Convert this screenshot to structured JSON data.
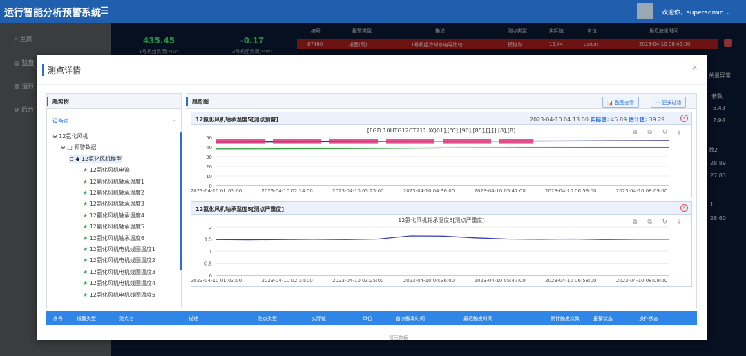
{
  "app": {
    "title": "运行智能分析预警系统",
    "menu_icon": "☰",
    "welcome": "欢迎你，superadmin ⌄"
  },
  "sidebar": {
    "items": [
      {
        "icon": "home-icon",
        "glyph": "⌂",
        "label": "主页"
      },
      {
        "icon": "doc-icon",
        "glyph": "▤",
        "label": "监盘"
      },
      {
        "icon": "doc-icon",
        "glyph": "▤",
        "label": "运行"
      },
      {
        "icon": "gear-icon",
        "glyph": "⚙",
        "label": "后台"
      }
    ]
  },
  "dashboard": {
    "kpis": [
      {
        "value": "435.45",
        "label": "1号机组负荷(MW)"
      },
      {
        "value": "-0.17",
        "label": "2号机组负荷(MW)"
      }
    ],
    "alarm_columns": [
      "编号",
      "报警类型",
      "描述",
      "测点类型",
      "实际值",
      "单位",
      "最近触发时间"
    ],
    "alarm_rows": [
      [
        "87460",
        "报警(高)",
        "1号机组冷却水电导比较",
        "模拟点",
        "15.44",
        "us/cm",
        "2023-04-10 08:45:00"
      ]
    ],
    "right_labels": [
      "关量异常",
      "参数",
      "5.43",
      "7.94",
      "数2",
      "28.89",
      "27.83",
      "1",
      "28.60"
    ]
  },
  "modal": {
    "title": "测点详情",
    "close": "×",
    "left_panel": {
      "title": "趋势树",
      "selector": "设备点",
      "tree": [
        {
          "label": "12氨化风机",
          "prefix": "⊖",
          "level": 0
        },
        {
          "label": "预警数据",
          "prefix": "⊖ □",
          "level": 1
        },
        {
          "label": "12氨化风机模型",
          "prefix": "⊖ ◆",
          "level": 2,
          "selected": true
        },
        {
          "label": "12氨化风机电流",
          "level": 3
        },
        {
          "label": "12氨化风机轴承温度1",
          "level": 3
        },
        {
          "label": "12氨化风机轴承温度2",
          "level": 3
        },
        {
          "label": "12氨化风机轴承温度3",
          "level": 3
        },
        {
          "label": "12氨化风机轴承温度4",
          "level": 3
        },
        {
          "label": "12氨化风机轴承温度5",
          "level": 3
        },
        {
          "label": "12氨化风机轴承温度6",
          "level": 3
        },
        {
          "label": "12氨化风机电机线圈温度1",
          "level": 3
        },
        {
          "label": "12氨化风机电机线圈温度2",
          "level": 3
        },
        {
          "label": "12氨化风机电机线圈温度3",
          "level": 3
        },
        {
          "label": "12氨化风机电机线圈温度4",
          "level": 3
        },
        {
          "label": "12氨化风机电机线圈温度5",
          "level": 3
        }
      ]
    },
    "right_panel": {
      "title": "趋势图",
      "btn_compare": "📊 整图查看",
      "btn_filter": "⋯ 更多过滤"
    },
    "table_columns": [
      "序号",
      "报警类型",
      "测点名",
      "描述",
      "测点类型",
      "实际值",
      "单位",
      "首次触发时间",
      "最近触发时间",
      "累计触发次数",
      "报警状态",
      "操作状态"
    ],
    "no_data": "暂无数据"
  },
  "chart_data": [
    {
      "type": "line",
      "panel_title": "12氨化风机轴承温度5[测点预警]",
      "time": "2023-04-10 04:13:00",
      "actual_label": "实际值:",
      "actual_value": "45.89",
      "estimate_label": "估计值:",
      "estimate_value": "39.29",
      "title": "[FGD.10HTG12CT211.XQ01],[℃],[90],[85],[],[],[8],[8]",
      "x_labels": [
        "2023-04-10 01:03:00",
        "2023-04-10 02:14:00",
        "2023-04-10 03:25:00",
        "2023-04-10 04:36:00",
        "2023-04-10 05:47:00",
        "2023-04-10 06:58:00",
        "2023-04-10 08:09:00"
      ],
      "ylim": [
        0,
        50
      ],
      "yticks": [
        0,
        10,
        20,
        30,
        40,
        50
      ],
      "series": [
        {
          "color": "#2a2f8a",
          "values": [
            45.0,
            45.2,
            45.5,
            45.7,
            45.9,
            46.0,
            46.1,
            46.3,
            46.5
          ]
        },
        {
          "color": "#2f9e3d",
          "values": [
            38.0,
            38.1,
            38.3,
            38.6,
            39.0,
            39.2,
            39.4,
            39.5,
            39.6
          ]
        },
        {
          "color": "#e0357a",
          "values": [
            46.0,
            46.0,
            46.0,
            46.0,
            46.0
          ]
        }
      ],
      "tool_icons": "⧉ ⧉ ↻ ⤓"
    },
    {
      "type": "line",
      "panel_title": "12氨化风机轴承温度5[测点严重度]",
      "title": "12氨化风机轴承温度5[测点严重度]",
      "x_labels": [
        "2023-04-10 01:03:00",
        "2023-04-10 02:14:00",
        "2023-04-10 03:25:00",
        "2023-04-10 04:36:00",
        "2023-04-10 05:47:00",
        "2023-04-10 06:58:00",
        "2023-04-10 08:09:00"
      ],
      "ylim": [
        0,
        2
      ],
      "yticks": [
        0,
        0.5,
        1,
        1.5,
        2
      ],
      "series": [
        {
          "color": "#3a3fb0",
          "values": [
            1.48,
            1.47,
            1.48,
            1.49,
            1.48,
            1.5,
            1.63,
            1.62,
            1.55,
            1.5,
            1.49,
            1.5,
            1.48,
            1.49,
            1.49
          ]
        }
      ],
      "tool_icons": "⧉ ⧉ ↻ ⤓"
    }
  ]
}
